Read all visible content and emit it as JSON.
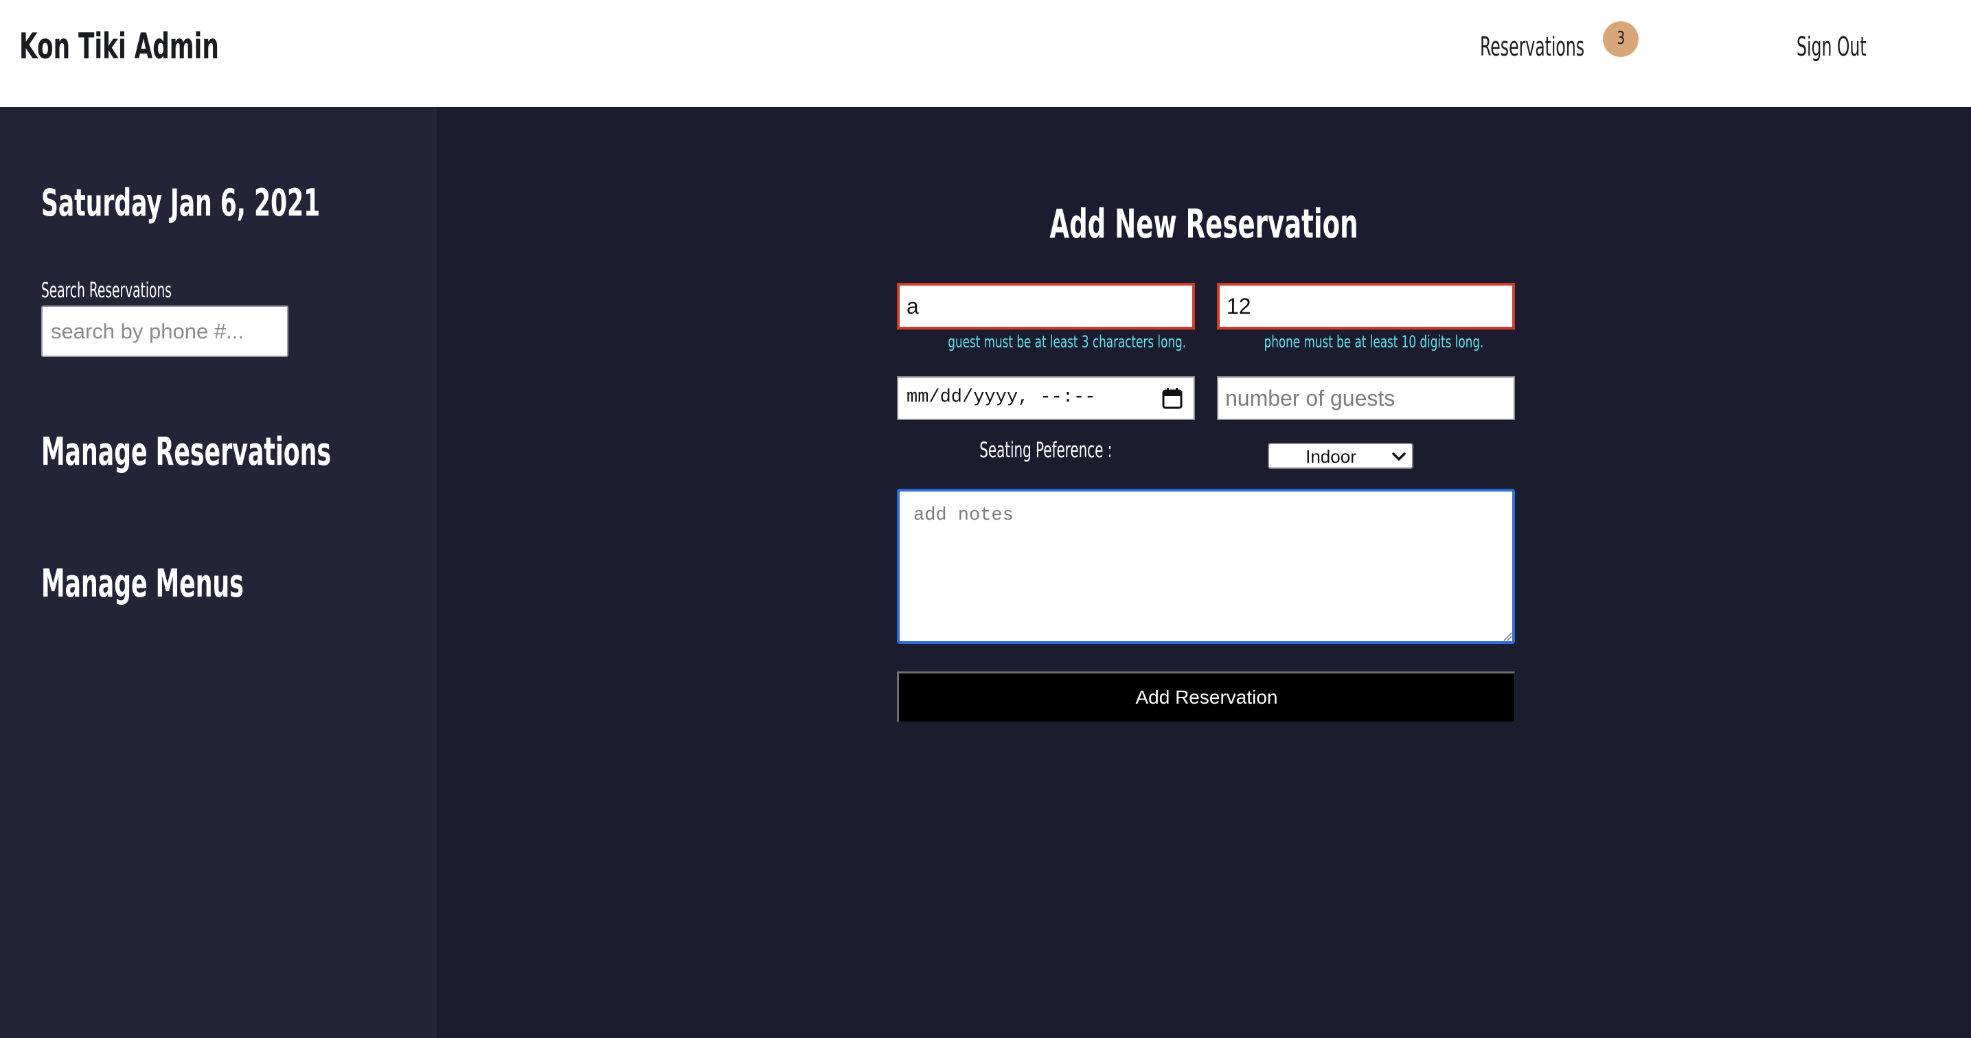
{
  "header": {
    "brand": "Kon Tiki Admin",
    "nav_reservations": "Reservations",
    "reservations_count": "3",
    "sign_out": "Sign Out"
  },
  "sidebar": {
    "date": "Saturday Jan 6, 2021",
    "search_label": "Search Reservations",
    "search_placeholder": "search by phone #...",
    "search_value": "",
    "links": [
      "Manage Reservations",
      "Manage Menus"
    ]
  },
  "form": {
    "title": "Add New Reservation",
    "guest_value": "a",
    "guest_error": "guest must be at least 3 characters long.",
    "phone_value": "12",
    "phone_error": "phone must be at least 10 digits long.",
    "datetime_placeholder": "mm/dd/yyyy, --:--",
    "guests_placeholder": "number of guests",
    "guests_value": "",
    "seating_label": "Seating Peference :",
    "seating_selected": "Indoor",
    "notes_placeholder": "add notes",
    "notes_value": "",
    "submit_label": "Add Reservation"
  },
  "colors": {
    "header_bg": "#ffffff",
    "sidebar_bg": "#242439",
    "main_bg": "#1b1c2f",
    "badge_bg": "#d9a679",
    "error_text": "#5fe3ea",
    "error_border": "#d23a2c",
    "focus_border": "#2b6fd6",
    "button_bg": "#000000"
  },
  "icons": {
    "calendar": "calendar-icon",
    "select": "chevron-down-icon"
  }
}
